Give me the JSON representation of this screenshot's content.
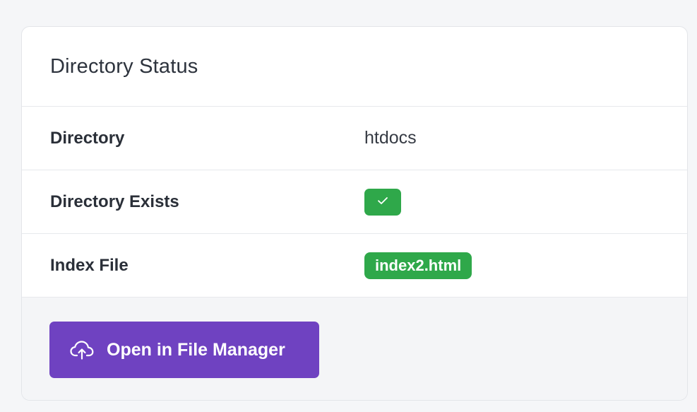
{
  "card": {
    "title": "Directory Status"
  },
  "rows": [
    {
      "label": "Directory",
      "value": "htdocs"
    },
    {
      "label": "Directory Exists",
      "value_icon": "check-icon",
      "status": true
    },
    {
      "label": "Index File",
      "value": "index2.html"
    }
  ],
  "footer": {
    "button_label": "Open in File Manager",
    "button_icon": "cloud-upload-icon"
  },
  "colors": {
    "success": "#2fa84a",
    "primary_button": "#6f42c1"
  }
}
